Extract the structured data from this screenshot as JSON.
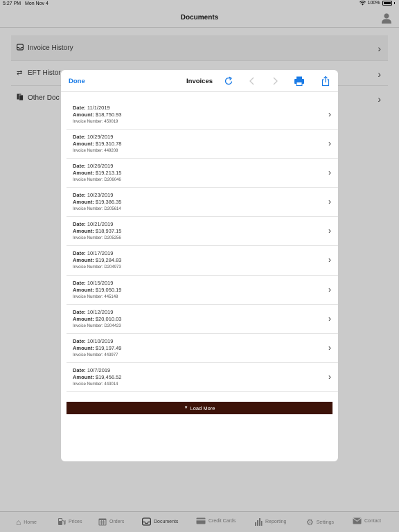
{
  "status": {
    "time": "5:27 PM",
    "date": "Mon Nov 4",
    "battery": "100%"
  },
  "navbar": {
    "title": "Documents"
  },
  "background_list": [
    {
      "label": "Invoice History",
      "icon": "inbox-icon"
    },
    {
      "label": "EFT Histor",
      "icon": "transfer-icon"
    },
    {
      "label": "Other Doc",
      "icon": "documents-icon"
    }
  ],
  "modal": {
    "done_label": "Done",
    "title": "Invoices",
    "labels": {
      "date": "Date:",
      "amount": "Amount:",
      "number": "Invoice Number:"
    },
    "invoices": [
      {
        "date": "11/1/2019",
        "amount": "$18,750.93",
        "number": "450019"
      },
      {
        "date": "10/29/2019",
        "amount": "$19,310.78",
        "number": "449208"
      },
      {
        "date": "10/26/2019",
        "amount": "$19,213.15",
        "number": "D206046"
      },
      {
        "date": "10/23/2019",
        "amount": "$19,386.35",
        "number": "D205614"
      },
      {
        "date": "10/21/2019",
        "amount": "$18,937.15",
        "number": "D205256"
      },
      {
        "date": "10/17/2019",
        "amount": "$19,284.83",
        "number": "D204973"
      },
      {
        "date": "10/15/2019",
        "amount": "$19,050.19",
        "number": "445148"
      },
      {
        "date": "10/12/2019",
        "amount": "$20,010.03",
        "number": "D204423"
      },
      {
        "date": "10/10/2019",
        "amount": "$19,197.49",
        "number": "443977"
      },
      {
        "date": "10/7/2019",
        "amount": "$19,456.52",
        "number": "443014"
      }
    ],
    "load_more_label": "Load More"
  },
  "tabs": [
    {
      "label": "Home",
      "icon": "home-icon"
    },
    {
      "label": "Prices",
      "icon": "fuel-pump-icon"
    },
    {
      "label": "Orders",
      "icon": "calendar-icon"
    },
    {
      "label": "Documents",
      "icon": "inbox-icon",
      "active": true
    },
    {
      "label": "Credit Cards",
      "icon": "credit-card-icon"
    },
    {
      "label": "Reporting",
      "icon": "bar-chart-icon"
    },
    {
      "label": "Settings",
      "icon": "gear-icon"
    },
    {
      "label": "Contact",
      "icon": "envelope-icon"
    }
  ],
  "colors": {
    "accent": "#1a7be6",
    "load_more_bg": "#3d1309"
  }
}
